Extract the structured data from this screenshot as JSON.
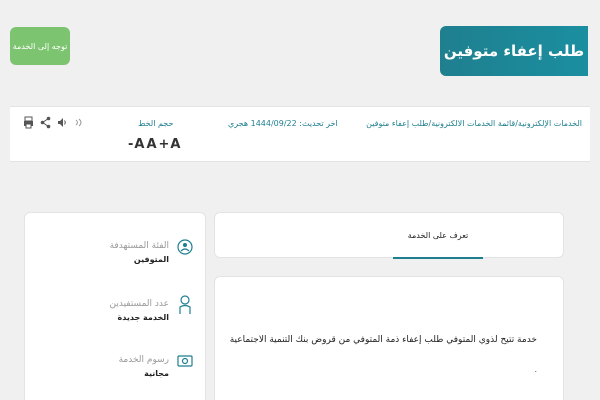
{
  "header": {
    "title": "طلب إعفاء متوفين",
    "go_button": "توجه إلى الخدمة"
  },
  "info_bar": {
    "breadcrumb": "الخدمات الإلكترونية/قائمة الخدمات الالكترونية/طلب إعفاء متوفين",
    "last_update": "اخر تحديث: 1444/09/22 هجري",
    "font_size_label": "حجم الخط",
    "font_decrease": "-A",
    "font_normal": "A",
    "font_increase": "+A",
    "tools": {
      "listen_icon": "speaker-icon",
      "share_icon": "share-icon",
      "print_icon": "print-icon"
    }
  },
  "sidebar": {
    "items": [
      {
        "label": "الفئة المستهدفة",
        "value": "المتوفين",
        "icon": "target-icon"
      },
      {
        "label": "عدد المستفيدين",
        "value": "الخدمة جديدة",
        "icon": "user-icon"
      },
      {
        "label": "رسوم الخدمة",
        "value": "مجانية",
        "icon": "money-icon"
      }
    ]
  },
  "tabs": {
    "active": "تعرف على الخدمة"
  },
  "description": {
    "text": "خدمة تتيح لذوي المتوفي طلب إعفاء ذمة المتوفي من قروض بنك التنمية الاجتماعية",
    "trailing": "."
  },
  "colors": {
    "brand": "#1f7f8f",
    "go_button": "#7cc470",
    "background": "#f0f0f0"
  }
}
